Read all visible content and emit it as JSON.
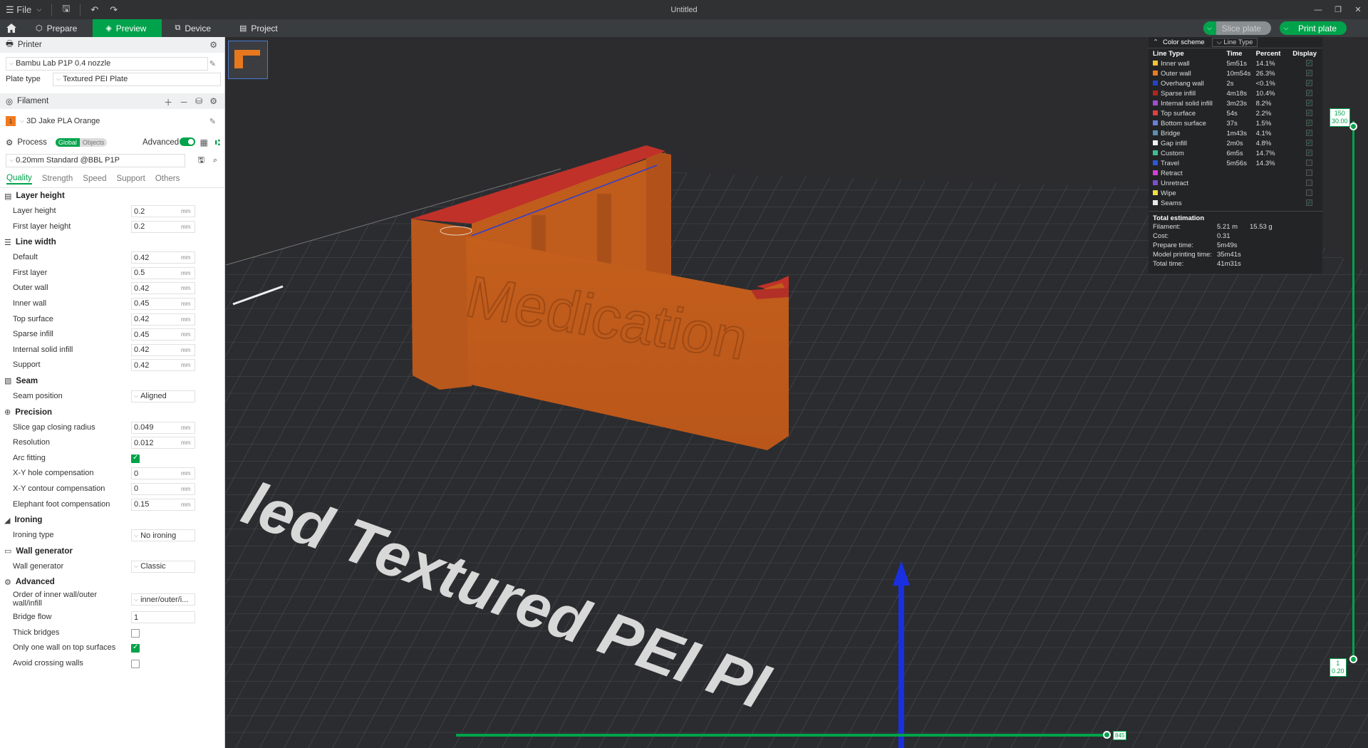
{
  "window": {
    "title": "Untitled",
    "file_label": "File"
  },
  "tabs": [
    {
      "label": "Prepare"
    },
    {
      "label": "Preview"
    },
    {
      "label": "Device"
    },
    {
      "label": "Project"
    }
  ],
  "actions": {
    "slice": "Slice plate",
    "print": "Print plate"
  },
  "sidebar": {
    "printer_header": "Printer",
    "printer_name": "Bambu Lab P1P 0.4 nozzle",
    "plate_type_label": "Plate type",
    "plate_type": "Textured PEI Plate",
    "filament_header": "Filament",
    "filament_index": "1",
    "filament_name": "3D Jake PLA Orange",
    "process_header": "Process",
    "seg_global": "Global",
    "seg_objects": "Objects",
    "advanced_label": "Advanced",
    "process_preset": "0.20mm Standard @BBL P1P",
    "sub_tabs": [
      "Quality",
      "Strength",
      "Speed",
      "Support",
      "Others"
    ]
  },
  "groups": {
    "layer_height": {
      "title": "Layer height",
      "rows": [
        {
          "label": "Layer height",
          "value": "0.2",
          "unit": "mm"
        },
        {
          "label": "First layer height",
          "value": "0.2",
          "unit": "mm"
        }
      ]
    },
    "line_width": {
      "title": "Line width",
      "rows": [
        {
          "label": "Default",
          "value": "0.42",
          "unit": "mm"
        },
        {
          "label": "First layer",
          "value": "0.5",
          "unit": "mm"
        },
        {
          "label": "Outer wall",
          "value": "0.42",
          "unit": "mm"
        },
        {
          "label": "Inner wall",
          "value": "0.45",
          "unit": "mm"
        },
        {
          "label": "Top surface",
          "value": "0.42",
          "unit": "mm"
        },
        {
          "label": "Sparse infill",
          "value": "0.45",
          "unit": "mm"
        },
        {
          "label": "Internal solid infill",
          "value": "0.42",
          "unit": "mm"
        },
        {
          "label": "Support",
          "value": "0.42",
          "unit": "mm"
        }
      ]
    },
    "seam": {
      "title": "Seam",
      "rows": [
        {
          "label": "Seam position",
          "value": "Aligned"
        }
      ]
    },
    "precision": {
      "title": "Precision",
      "rows": [
        {
          "label": "Slice gap closing radius",
          "value": "0.049",
          "unit": "mm"
        },
        {
          "label": "Resolution",
          "value": "0.012",
          "unit": "mm"
        },
        {
          "label": "Arc fitting"
        },
        {
          "label": "X-Y hole compensation",
          "value": "0",
          "unit": "mm"
        },
        {
          "label": "X-Y contour compensation",
          "value": "0",
          "unit": "mm"
        },
        {
          "label": "Elephant foot compensation",
          "value": "0.15",
          "unit": "mm"
        }
      ]
    },
    "ironing": {
      "title": "Ironing",
      "rows": [
        {
          "label": "Ironing type",
          "value": "No ironing"
        }
      ]
    },
    "wall_generator": {
      "title": "Wall generator",
      "rows": [
        {
          "label": "Wall generator",
          "value": "Classic"
        }
      ]
    },
    "advanced": {
      "title": "Advanced",
      "rows": [
        {
          "label": "Order of inner wall/outer wall/infill",
          "value": "inner/outer/i..."
        },
        {
          "label": "Bridge flow",
          "value": "1"
        },
        {
          "label": "Thick bridges"
        },
        {
          "label": "Only one wall on top surfaces"
        },
        {
          "label": "Avoid crossing walls"
        }
      ]
    }
  },
  "checkboxes": {
    "arc_fitting": true,
    "thick_bridges": false,
    "only_one_wall": true,
    "avoid_crossing": false
  },
  "legend": {
    "color_scheme_label": "Color scheme",
    "scheme": "Line Type",
    "headers": [
      "Line Type",
      "Time",
      "Percent",
      "Display"
    ],
    "rows": [
      {
        "name": "Inner wall",
        "time": "5m51s",
        "percent": "14.1%",
        "color": "#f4c430",
        "display": true
      },
      {
        "name": "Outer wall",
        "time": "10m54s",
        "percent": "26.3%",
        "color": "#f07a1e",
        "display": true
      },
      {
        "name": "Overhang wall",
        "time": "2s",
        "percent": "<0.1%",
        "color": "#2443c8",
        "display": true
      },
      {
        "name": "Sparse infill",
        "time": "4m18s",
        "percent": "10.4%",
        "color": "#b3241c",
        "display": true
      },
      {
        "name": "Internal solid infill",
        "time": "3m23s",
        "percent": "8.2%",
        "color": "#a24ccf",
        "display": true
      },
      {
        "name": "Top surface",
        "time": "54s",
        "percent": "2.2%",
        "color": "#e04040",
        "display": true
      },
      {
        "name": "Bottom surface",
        "time": "37s",
        "percent": "1.5%",
        "color": "#6a7fd8",
        "display": true
      },
      {
        "name": "Bridge",
        "time": "1m43s",
        "percent": "4.1%",
        "color": "#5c8fb0",
        "display": true
      },
      {
        "name": "Gap infill",
        "time": "2m0s",
        "percent": "4.8%",
        "color": "#f2f2f2",
        "display": true
      },
      {
        "name": "Custom",
        "time": "6m5s",
        "percent": "14.7%",
        "color": "#3fbf8c",
        "display": true
      },
      {
        "name": "Travel",
        "time": "5m56s",
        "percent": "14.3%",
        "color": "#2f56d8",
        "display": false
      },
      {
        "name": "Retract",
        "time": "",
        "percent": "",
        "color": "#d53fd5",
        "display": false
      },
      {
        "name": "Unretract",
        "time": "",
        "percent": "",
        "color": "#7a4fcf",
        "display": false
      },
      {
        "name": "Wipe",
        "time": "",
        "percent": "",
        "color": "#f0e040",
        "display": false
      },
      {
        "name": "Seams",
        "time": "",
        "percent": "",
        "color": "#e8e8e8",
        "display": true
      }
    ],
    "total_label": "Total estimation",
    "estimation": [
      {
        "k": "Filament:",
        "v": "5.21 m",
        "v2": "15.53 g"
      },
      {
        "k": "Cost:",
        "v": "0.31",
        "v2": ""
      },
      {
        "k": "Prepare time:",
        "v": "5m49s",
        "v2": ""
      },
      {
        "k": "Model printing time:",
        "v": "35m41s",
        "v2": ""
      },
      {
        "k": "Total time:",
        "v": "41m31s",
        "v2": ""
      }
    ]
  },
  "layer_slider": {
    "top_layer": "150",
    "top_height": "30.00",
    "bottom_layer": "1",
    "bottom_height": "0.20"
  },
  "move_slider": {
    "value": "845"
  },
  "scene": {
    "model_text": "Medication",
    "plate_text": "Bambu Textured PEI Plate",
    "plate_text_visible": "led Textured PEI Pl"
  }
}
